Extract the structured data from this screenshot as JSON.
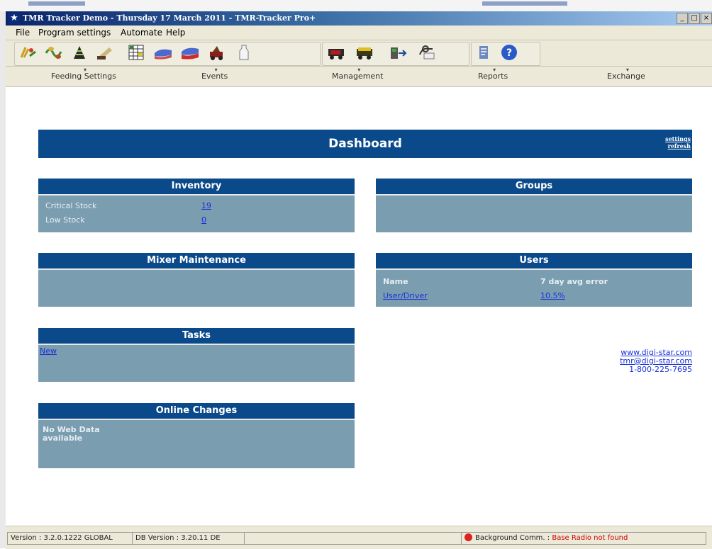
{
  "window": {
    "title": "TMR Tracker Demo - Thursday 17 March 2011 - TMR-Tracker Pro+",
    "controls": [
      "_",
      "□",
      "×"
    ]
  },
  "menu": [
    "File",
    "Program settings",
    "Automate",
    "Help"
  ],
  "toolbar": {
    "icons": [
      "feed-ration-icon",
      "feed-ingredient-icon",
      "feed-mix-icon",
      "loader-icon",
      "ration-table-icon",
      "cattle-blue-icon",
      "cattle-red-icon",
      "feed-truck-icon",
      "milk-bottle-icon",
      "mixer-truck-icon",
      "mixer-wagon-icon",
      "transfer-data-icon",
      "scale-icon",
      "notes-icon",
      "help-icon"
    ]
  },
  "sections": [
    "Feeding Settings",
    "Events",
    "Management",
    "Reports",
    "Exchange"
  ],
  "dashboard": {
    "title": "Dashboard",
    "settings_link": "settings",
    "refresh_link": "refresh"
  },
  "inventory": {
    "title": "Inventory",
    "rows": [
      {
        "label": "Critical Stock",
        "value": "19"
      },
      {
        "label": "Low Stock",
        "value": "0"
      }
    ]
  },
  "groups": {
    "title": "Groups"
  },
  "mixer_maintenance": {
    "title": "Mixer Maintenance"
  },
  "users": {
    "title": "Users",
    "col_name": "Name",
    "col_error": "7 day avg error",
    "row_name": "User/Driver",
    "row_error": "10.5%"
  },
  "tasks": {
    "title": "Tasks",
    "new_link": "New"
  },
  "online_changes": {
    "title": "Online Changes",
    "message": "No Web Data available"
  },
  "contact": {
    "website": "www.digi-star.com",
    "email": "tmr@digi-star.com",
    "phone": "1-800-225-7695"
  },
  "status": {
    "version": "Version : 3.2.0.1222 GLOBAL",
    "db_version": "DB Version : 3.20.11 DE",
    "bg_label": "Background Comm. :",
    "bg_value": "Base Radio not found"
  },
  "colors": {
    "header_blue": "#0b4a8a",
    "panel_gray_blue": "#7b9db0",
    "link_blue": "#1830d8",
    "error_red": "#d00000"
  }
}
